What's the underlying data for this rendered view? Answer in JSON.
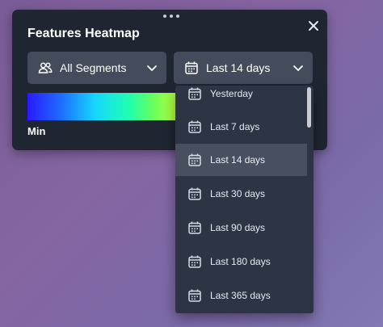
{
  "panel": {
    "title": "Features Heatmap",
    "close_icon": "close-icon",
    "drag_icon": "drag-handle-icon"
  },
  "filters": {
    "segments": {
      "label": "All Segments",
      "icon": "users-icon"
    },
    "date_range": {
      "label": "Last 14 days",
      "icon": "calendar-icon"
    }
  },
  "legend": {
    "min_label": "Min",
    "gradient_colors": [
      "#2a1aff",
      "#1e6bff",
      "#16d6ff",
      "#1fffb0",
      "#6eff5a",
      "#b8ff3a"
    ]
  },
  "dropdown": {
    "options": [
      {
        "label": "Yesterday",
        "selected": false
      },
      {
        "label": "Last 7 days",
        "selected": false
      },
      {
        "label": "Last 14 days",
        "selected": true
      },
      {
        "label": "Last 30 days",
        "selected": false
      },
      {
        "label": "Last 90 days",
        "selected": false
      },
      {
        "label": "Last 180 days",
        "selected": false
      },
      {
        "label": "Last 365 days",
        "selected": false
      }
    ]
  },
  "colors": {
    "panel_bg": "#1f2632",
    "select_bg": "#444c5c",
    "dropdown_bg": "#2d3544",
    "selected_option_bg": "#48505f"
  }
}
